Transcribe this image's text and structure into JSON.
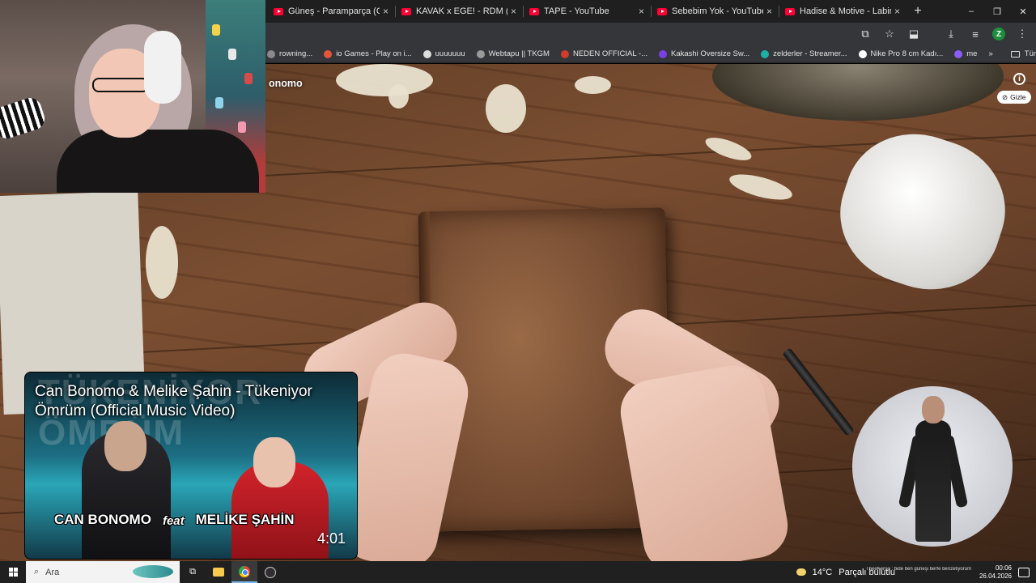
{
  "browser": {
    "tabs": [
      {
        "title": "Güneş - Paramparça (Official V",
        "close": "×"
      },
      {
        "title": "KAVAK x EGE! - RDM (Official V",
        "close": "×"
      },
      {
        "title": "TAPE - YouTube",
        "close": "×"
      },
      {
        "title": "Sebebim Yok - YouTube",
        "close": "×"
      },
      {
        "title": "Hadise & Motive - Labirent (Of",
        "close": "×"
      }
    ],
    "new_tab": "+",
    "window_controls": [
      "–",
      "❐",
      "✕"
    ],
    "profile_initial": "Z",
    "bookmarks": [
      {
        "label": "rowning...",
        "color": "#8a8a8a"
      },
      {
        "label": "io Games - Play on i...",
        "color": "#e2573b"
      },
      {
        "label": "uuuuuuu",
        "color": "#dddddd"
      },
      {
        "label": "Webtapu || TKGM",
        "color": "#9a9a9a"
      },
      {
        "label": "NEDEN OFFICIAL -...",
        "color": "#d33a2c"
      },
      {
        "label": "Kakashi Oversize Sw...",
        "color": "#7b3fe4"
      },
      {
        "label": "zelderler - Streamer...",
        "color": "#19b3a6"
      },
      {
        "label": "Nike Pro 8 cm Kadı...",
        "color": "#ffffff"
      },
      {
        "label": "me",
        "color": "#8b5cf6"
      }
    ],
    "more_bookmarks": "»",
    "all_bookmarks": "Tüm Yer İşaretleri"
  },
  "video": {
    "title_fragment": "onomo",
    "hide_label": "Gizle",
    "info_glyph": "i"
  },
  "thumbnail": {
    "ghost_text": "TÜKENİYOR ÖMRÜM",
    "title": "Can Bonomo & Melike Şahin - Tükeniyor Ömrüm (Official Music Video)",
    "artist1": "CAN BONOMO",
    "feat": "feat",
    "artist2": "MELİKE ŞAHİN",
    "duration": "4:01"
  },
  "taskbar": {
    "search_placeholder": "Ara",
    "temperature": "14°C",
    "weather": "Parçalı bulutlu",
    "time": "00:06",
    "date": "26.04.2026",
    "chat_ticker": "TheeKeroo : bide ben güneşi berfe benzetiyorum"
  }
}
